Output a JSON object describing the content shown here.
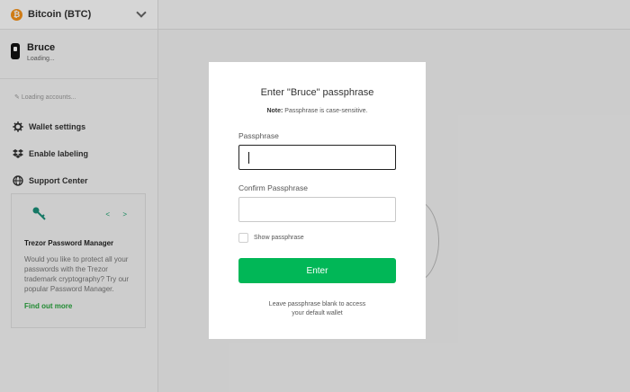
{
  "sidebar": {
    "coin": {
      "icon": "bitcoin-icon",
      "symbol_glyph": "₿",
      "label": "Bitcoin (BTC)"
    },
    "device": {
      "name": "Bruce",
      "status": "Loading..."
    },
    "loading_accounts": "Loading accounts...",
    "items": [
      {
        "icon": "gear-icon",
        "label": "Wallet settings"
      },
      {
        "icon": "dropbox-icon",
        "label": "Enable labeling"
      },
      {
        "icon": "globe-icon",
        "label": "Support Center"
      }
    ],
    "promo": {
      "icon": "key-icon",
      "arrows": "< >",
      "title": "Trezor Password Manager",
      "text": "Would you like to protect all your passwords with the Trezor trademark cryptography? Try our popular Password Manager.",
      "link": "Find out more"
    }
  },
  "modal": {
    "title": "Enter \"Bruce\" passphrase",
    "note_bold": "Note:",
    "note_text": " Passphrase is case-sensitive.",
    "passphrase_label": "Passphrase",
    "passphrase_value": "",
    "confirm_label": "Confirm Passphrase",
    "confirm_value": "",
    "show_label": "Show passphrase",
    "enter_label": "Enter",
    "hint_line1": "Leave passphrase blank to access",
    "hint_line2": "your default wallet"
  },
  "colors": {
    "accent_green": "#01b757",
    "link_green": "#27a53c",
    "bitcoin_orange": "#f7931a"
  }
}
